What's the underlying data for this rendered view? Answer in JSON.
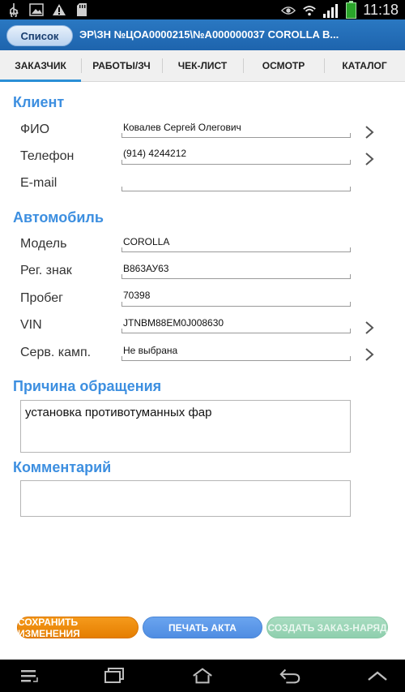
{
  "status_bar": {
    "left_icons": [
      "usb-icon",
      "image-icon",
      "warning-icon",
      "sd-card-icon"
    ],
    "right_icons": [
      "eye-icon",
      "wifi-icon",
      "signal-icon",
      "battery-icon"
    ],
    "time": "11:18"
  },
  "header": {
    "back_label": "Список",
    "title": "ЭР\\ЗН №ЦОА0000215\\№А000000037 COROLLA В..."
  },
  "tabs": [
    {
      "label": "ЗАКАЗЧИК",
      "active": true
    },
    {
      "label": "РАБОТЫ/ЗЧ",
      "active": false
    },
    {
      "label": "ЧЕК-ЛИСТ",
      "active": false
    },
    {
      "label": "ОСМОТР",
      "active": false
    },
    {
      "label": "КАТАЛОГ",
      "active": false
    }
  ],
  "client": {
    "title": "Клиент",
    "name_label": "ФИО",
    "name_value": "Ковалев Сергей Олегович",
    "phone_label": "Телефон",
    "phone_value": "(914) 4244212",
    "email_label": "E-mail",
    "email_value": ""
  },
  "car": {
    "title": "Автомобиль",
    "model_label": "Модель",
    "model_value": "COROLLA",
    "plate_label": "Рег. знак",
    "plate_value": "В863АУ63",
    "mileage_label": "Пробег",
    "mileage_value": "70398",
    "vin_label": "VIN",
    "vin_value": "JTNBM88EM0J008630",
    "campaign_label": "Серв. камп.",
    "campaign_value": "Не выбрана"
  },
  "reason": {
    "title": "Причина обращения",
    "value": "установка противотуманных фар"
  },
  "comment": {
    "title": "Комментарий",
    "value": ""
  },
  "actions": {
    "save_label": "СОХРАНИТЬ ИЗМЕНЕНИЯ",
    "print_label": "ПЕЧАТЬ АКТА",
    "create_label": "СОЗДАТЬ ЗАКАЗ-НАРЯД"
  },
  "colors": {
    "accent": "#3d8fe0",
    "header_bg": "#2070b8",
    "save_button": "#f08c10",
    "print_button": "#5b96e8",
    "create_button_disabled": "#9bd6b8"
  },
  "nav_bar": [
    "menu-icon",
    "recent-apps-icon",
    "home-icon",
    "back-icon",
    "expand-icon"
  ]
}
